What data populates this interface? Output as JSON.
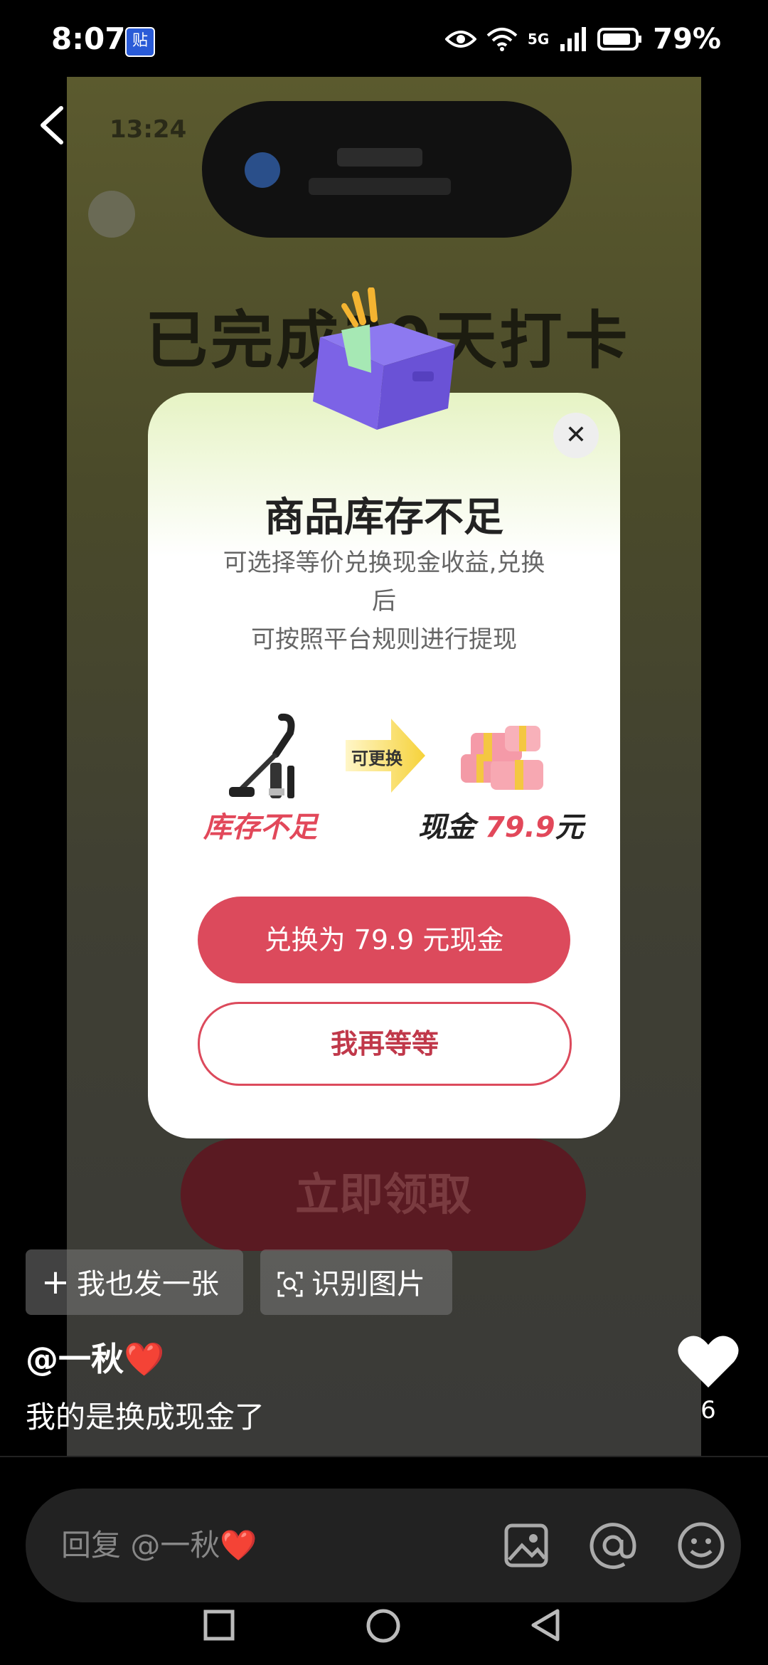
{
  "status_bar": {
    "time": "8:07",
    "notification_badge": "贴",
    "network": "5G",
    "battery": "79%"
  },
  "background_image": {
    "blurred_time": "13:24",
    "blurred_title": "已完成30天打卡",
    "blurred_button": "立即领取"
  },
  "modal": {
    "title": "商品库存不足",
    "description_line1": "可选择等价兑换现金收益,兑换",
    "description_line2": "后",
    "description_line3": "可按照平台规则进行提现",
    "arrow_label": "可更换",
    "out_of_stock_label": "库存不足",
    "cash_prefix": "现金",
    "cash_value": "79.9",
    "cash_suffix": "元",
    "exchange_button": "兑换为 79.9 元现金",
    "wait_button": "我再等等",
    "close_symbol": "✕"
  },
  "actions": {
    "post_too": "我也发一张",
    "recognize_image": "识别图片"
  },
  "post": {
    "username": "@一秋",
    "username_emoji": "❤️",
    "caption": "我的是换成现金了",
    "like_count": "6"
  },
  "reply_bar": {
    "placeholder": "回复 @一秋",
    "placeholder_emoji": "❤️"
  },
  "icons": {
    "back": "chevron-left-icon",
    "image": "image-icon",
    "mention": "at-icon",
    "emoji": "smile-icon"
  },
  "colors": {
    "accent_red": "#dc4a5c",
    "modal_bg": "#ffffff"
  }
}
